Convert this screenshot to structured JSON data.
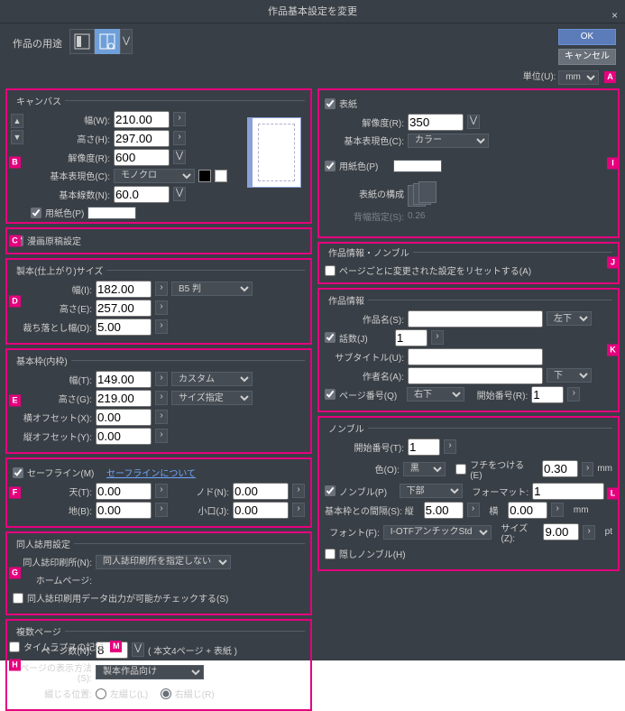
{
  "title": "作品基本設定を変更",
  "header": {
    "purpose_label": "作品の用途",
    "ok": "OK",
    "cancel": "キャンセル"
  },
  "unit": {
    "label": "単位(U):",
    "value": "mm"
  },
  "callouts": {
    "A": "A",
    "B": "B",
    "C": "C",
    "D": "D",
    "E": "E",
    "F": "F",
    "G": "G",
    "H": "H",
    "I": "I",
    "J": "J",
    "K": "K",
    "L": "L",
    "M": "M"
  },
  "canvas": {
    "legend": "キャンバス",
    "width_lbl": "幅(W):",
    "width": "210.00",
    "height_lbl": "高さ(H):",
    "height": "297.00",
    "res_lbl": "解像度(R):",
    "res": "600",
    "basecolor_lbl": "基本表現色(C):",
    "basecolor": "モノクロ",
    "linew_lbl": "基本線数(N):",
    "linew": "60.0",
    "papercolor_lbl": "用紙色(P)"
  },
  "manga_chk": "漫画原稿設定",
  "finish": {
    "legend": "製本(仕上がり)サイズ",
    "width_lbl": "幅(I):",
    "width": "182.00",
    "height_lbl": "高さ(E):",
    "height": "257.00",
    "bleed_lbl": "裁ち落とし幅(D):",
    "bleed": "5.00",
    "preset": "B5 判"
  },
  "inner": {
    "legend": "基本枠(内枠)",
    "width_lbl": "幅(T):",
    "width": "149.00",
    "height_lbl": "高さ(G):",
    "height": "219.00",
    "hoff_lbl": "横オフセット(X):",
    "hoff": "0.00",
    "voff_lbl": "縦オフセット(Y):",
    "voff": "0.00",
    "preset": "カスタム",
    "size_spec": "サイズ指定"
  },
  "safe": {
    "chk": "セーフライン(M)",
    "link": "セーフラインについて",
    "ten_lbl": "天(T):",
    "ten": "0.00",
    "nodo_lbl": "ノド(N):",
    "nodo": "0.00",
    "chi_lbl": "地(B):",
    "chi": "0.00",
    "koguchi_lbl": "小口(J):",
    "koguchi": "0.00"
  },
  "doujin": {
    "legend": "同人誌用設定",
    "printer_lbl": "同人誌印刷所(N):",
    "printer": "同人誌印刷所を指定しない",
    "homepage_lbl": "ホームページ:",
    "check_lbl": "同人誌印刷用データ出力が可能かチェックする(S)"
  },
  "pages": {
    "legend": "複数ページ",
    "count_lbl": "ページ数(N):",
    "count": "8",
    "count_note": "( 本文4ページ + 表紙 )",
    "disp_lbl": "ページの表示方法(S):",
    "disp": "製本作品向け",
    "bind_lbl": "綴じる位置:",
    "bind_left": "左綴じ(L)",
    "bind_right": "右綴じ(R)"
  },
  "cover": {
    "chk": "表紙",
    "res_lbl": "解像度(R):",
    "res": "350",
    "basecolor_lbl": "基本表現色(C):",
    "basecolor": "カラー",
    "papercolor_lbl": "用紙色(P)",
    "struct_lbl": "表紙の構成",
    "spine_lbl": "背幅指定(S):",
    "spine": "0.26"
  },
  "infonb": {
    "legend": "作品情報・ノンブル",
    "reset_lbl": "ページごとに変更された設定をリセットする(A)"
  },
  "info": {
    "legend": "作品情報",
    "title_lbl": "作品名(S):",
    "title_pos": "左下",
    "epi_chk": "話数(J)",
    "epi_val": "1",
    "sub_lbl": "サブタイトル(U):",
    "author_lbl": "作者名(A):",
    "author_pos": "下",
    "pageno_chk": "ページ番号(Q)",
    "pageno_pos": "右下",
    "start_lbl": "開始番号(R):",
    "start": "1"
  },
  "nombre": {
    "legend": "ノンブル",
    "start_lbl": "開始番号(T):",
    "start": "1",
    "color_lbl": "色(O):",
    "color": "黒",
    "edge_lbl": "フチをつける(E)",
    "edge": "0.30",
    "mm": "mm",
    "chk": "ノンブル(P)",
    "pos": "下部",
    "fmt_lbl": "フォーマット:",
    "fmt": "1",
    "gap_lbl": "基本枠との間隔(S): 縦",
    "gap_v": "5.00",
    "gap_h_lbl": "横",
    "gap_h": "0.00",
    "font_lbl": "フォント(F):",
    "font": "I-OTFアンチックStd B",
    "size_lbl": "サイズ(Z):",
    "size": "9.00",
    "pt": "pt",
    "hidden_lbl": "隠しノンブル(H)"
  },
  "timelapse": "タイムラプスの記録"
}
